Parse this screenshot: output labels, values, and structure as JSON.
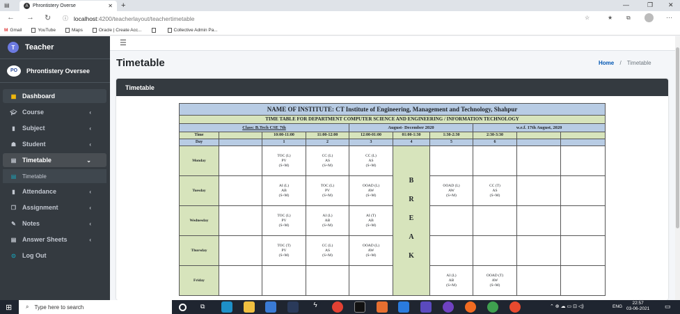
{
  "browser": {
    "tab_title": "Phrontistery Overse",
    "url_host": "localhost",
    "url_rest": ":4200/teacherlayout/teachertimetable",
    "bookmarks": [
      "Gmail",
      "YouTube",
      "Maps",
      "Oracle | Create Acc...",
      "",
      "Collective Admin Pa..."
    ]
  },
  "sidebar": {
    "brand": "Teacher",
    "user": "Phrontistery Oversee",
    "items": [
      {
        "label": "Dashboard",
        "icon": "grid-icon"
      },
      {
        "label": "Course",
        "icon": "graduation-cap-icon"
      },
      {
        "label": "Subject",
        "icon": "file-icon"
      },
      {
        "label": "Student",
        "icon": "user-icon"
      },
      {
        "label": "Timetable",
        "icon": "calendar-icon"
      },
      {
        "label": "Timetable",
        "icon": "calendar-icon"
      },
      {
        "label": "Attendance",
        "icon": "clipboard-icon"
      },
      {
        "label": "Assignment",
        "icon": "copy-icon"
      },
      {
        "label": "Notes",
        "icon": "edit-icon"
      },
      {
        "label": "Answer Sheets",
        "icon": "document-icon"
      },
      {
        "label": "Log Out",
        "icon": "circle-icon"
      }
    ]
  },
  "page": {
    "title": "Timetable",
    "breadcrumb_home": "Home",
    "breadcrumb_sep": "/",
    "breadcrumb_current": "Timetable",
    "card_title": "Timetable"
  },
  "timetable": {
    "institute": "NAME OF INSTITUTE: CT Institute of Engineering, Management and Technology, Shahpur",
    "department": "TIME TABLE FOR DEPARTMENT COMPUTER SCIENCE AND ENGINEERING / INFORMATION TECHNOLOGY",
    "class_label": "Class: B.Tech CSE 7th",
    "session": "August- December 2020",
    "wef": "w.e.f. 17th August, 2020",
    "time_label": "Time",
    "day_label": "Day",
    "times": [
      "",
      "10:00-11:00",
      "11:00-12:00",
      "12:00-01:00",
      "01:00-1:30",
      "1:30-2:30",
      "2:30-3:30",
      "",
      ""
    ],
    "days_nums": [
      "",
      "1",
      "2",
      "3",
      "4",
      "5",
      "6",
      "",
      ""
    ],
    "break_letters": [
      "B",
      "R",
      "E",
      "A",
      "K"
    ],
    "rows": [
      {
        "day": "Monday",
        "cells": [
          "",
          "TOC (L)\nPV\n(S+M)",
          "CC (L)\nAS\n(S+M)",
          "CC (L)\nAS\n(S+M)",
          "",
          "",
          "",
          ""
        ]
      },
      {
        "day": "Tuesday",
        "cells": [
          "",
          "AI (L)\nAB\n(S+M)",
          "TOC (L)\nPV\n(S+M)",
          "OOAD (L)\nAW\n(S+M)",
          "OOAD (L)\nAW\n(S+M)",
          "CC (T)\nAS\n(S+M)",
          "",
          ""
        ]
      },
      {
        "day": "Wednesday",
        "cells": [
          "",
          "TOC (L)\nPV\n(S+M)",
          "AI (L)\nAB\n(S+M)",
          "AI (T)\nAB\n(S+M)",
          "",
          "",
          "",
          ""
        ]
      },
      {
        "day": "Thursday",
        "cells": [
          "",
          "TOC (T)\nPV\n(S+M)",
          "CC (L)\nAS\n(S+M)",
          "OOAD (L)\nAW\n(S+M)",
          "",
          "",
          "",
          ""
        ]
      },
      {
        "day": "Friday",
        "cells": [
          "",
          "",
          "",
          "",
          "AI (L)\nAB\n(S+M)",
          "OOAD (T)\nAW\n(S+M)",
          "",
          ""
        ]
      }
    ]
  },
  "taskbar": {
    "search_placeholder": "Type here to search",
    "time": "22:57",
    "date": "03-06-2021",
    "lang": "ENG"
  }
}
